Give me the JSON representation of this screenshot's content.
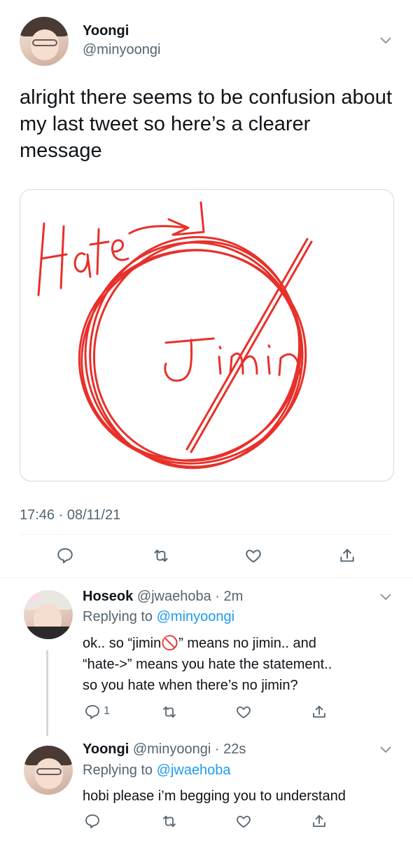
{
  "main_tweet": {
    "name": "Yoongi",
    "handle": "@minyoongi",
    "text": "alright there seems to be confusion about my last tweet so here’s a clearer message",
    "media": {
      "word_top": "Hate",
      "word_bottom": "Jimin"
    },
    "timestamp": "17:46 · 08/11/21"
  },
  "replies": [
    {
      "name": "Hoseok",
      "meta": "@jwaehoba · 2m",
      "replying_prefix": "Replying to",
      "replying_to": "@minyoongi",
      "line1": "ok.. so “jimin🚫” means no jimin.. and",
      "line2": "“hate->” means you hate the statement..",
      "line3": "so you hate when there’s no jimin?",
      "reply_count": "1"
    },
    {
      "name": "Yoongi",
      "meta": "@minyoongi · 22s",
      "replying_prefix": "Replying to",
      "replying_to": "@jwaehoba",
      "line1": "hobi please i’m begging you to understand"
    }
  ],
  "colors": {
    "text": "#0f1419",
    "muted": "#536471",
    "link": "#1d9bf0",
    "drawing_red": "#e8302a"
  },
  "icons": [
    "reply-icon",
    "retweet-icon",
    "like-icon",
    "share-icon",
    "chevron-down-icon"
  ]
}
